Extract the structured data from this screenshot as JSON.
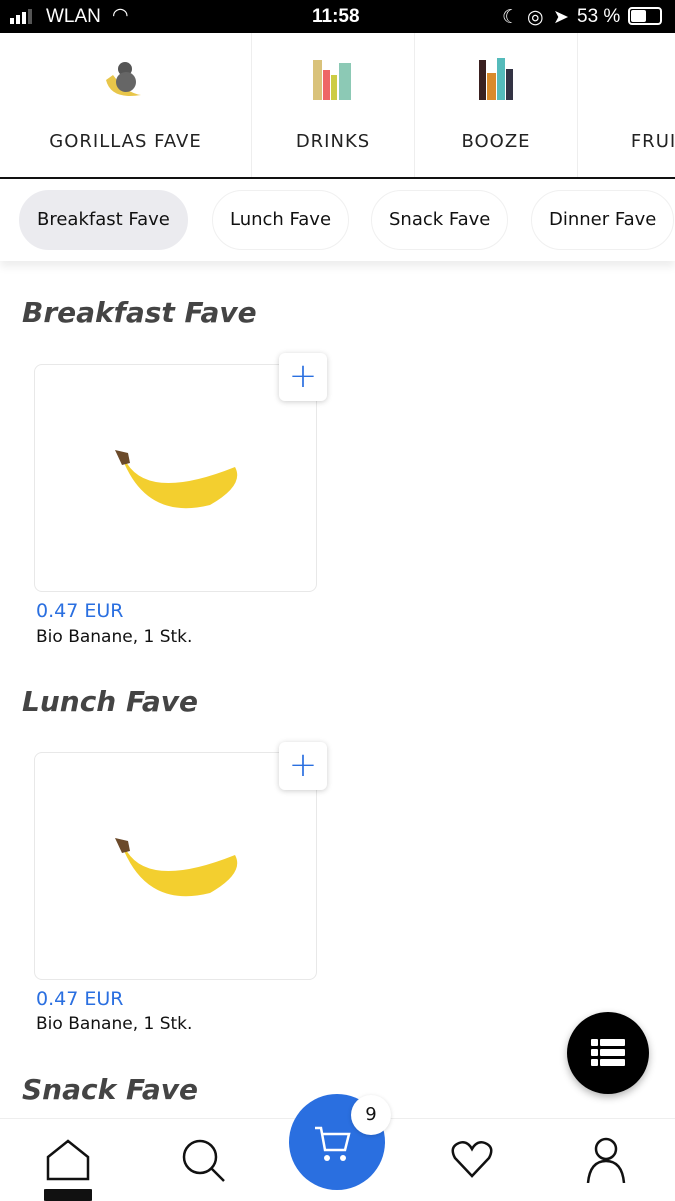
{
  "status": {
    "carrier": "WLAN",
    "time": "11:58",
    "battery": "53 %"
  },
  "categories": [
    {
      "label": "GORILLAS FAVE",
      "active": true,
      "icon": "gorilla-banana-image"
    },
    {
      "label": "DRINKS",
      "icon": "drinks-image"
    },
    {
      "label": "BOOZE",
      "icon": "booze-image"
    },
    {
      "label": "FRUIT",
      "icon": "fruit-image"
    }
  ],
  "chips": [
    {
      "label": "Breakfast Fave",
      "active": true
    },
    {
      "label": "Lunch Fave"
    },
    {
      "label": "Snack Fave"
    },
    {
      "label": "Dinner Fave"
    }
  ],
  "sections": [
    {
      "title": "Breakfast Fave",
      "products": [
        {
          "price": "0.47 EUR",
          "name": "Bio Banane, 1 Stk."
        }
      ]
    },
    {
      "title": "Lunch Fave",
      "products": [
        {
          "price": "0.47 EUR",
          "name": "Bio Banane, 1 Stk."
        }
      ]
    },
    {
      "title": "Snack Fave"
    }
  ],
  "cart": {
    "count": "9"
  },
  "colors": {
    "accent": "#2a6fe0"
  }
}
